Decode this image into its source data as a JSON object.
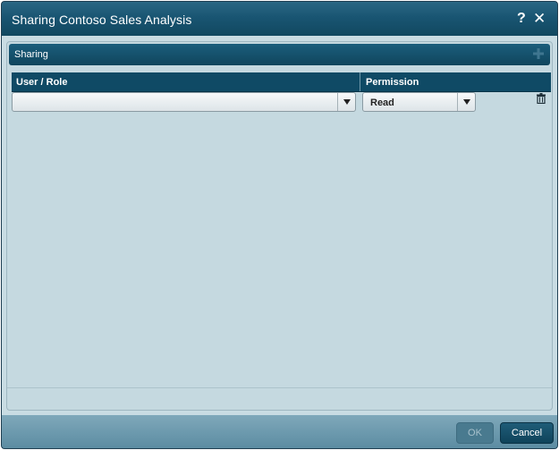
{
  "dialog": {
    "title": "Sharing Contoso Sales Analysis",
    "help_icon": "?",
    "close_icon": "✕"
  },
  "panel": {
    "title": "Sharing"
  },
  "table": {
    "columns": [
      "User / Role",
      "Permission"
    ],
    "rows": [
      {
        "user_role": "",
        "permission": "Read"
      }
    ]
  },
  "footer": {
    "ok_label": "OK",
    "cancel_label": "Cancel"
  },
  "icons": {
    "add": "plus-icon",
    "delete": "trash-icon",
    "dropdown": "chevron-down-icon"
  },
  "colors": {
    "title_bar": "#195572",
    "panel_bg": "#c5d9e0",
    "header_bg": "#0f4a65"
  }
}
